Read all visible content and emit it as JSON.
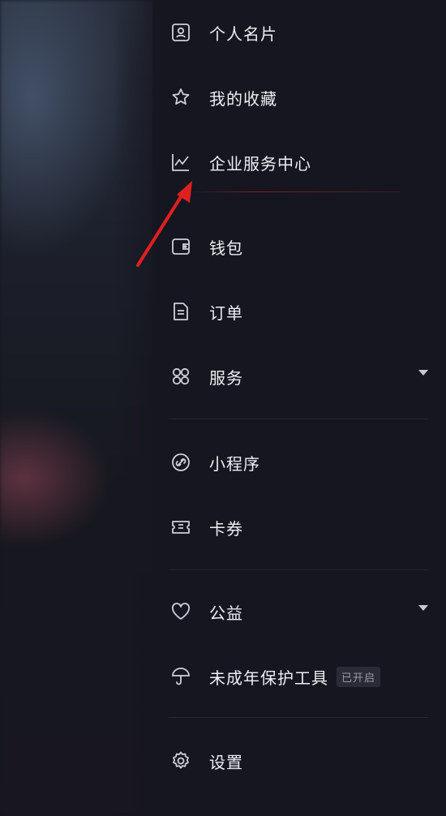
{
  "menu": {
    "items": [
      {
        "label": "个人名片",
        "icon": "contact-card-icon"
      },
      {
        "label": "我的收藏",
        "icon": "star-icon"
      },
      {
        "label": "企业服务中心",
        "icon": "trend-chart-icon"
      },
      {
        "label": "钱包",
        "icon": "wallet-icon"
      },
      {
        "label": "订单",
        "icon": "document-icon"
      },
      {
        "label": "服务",
        "icon": "grid-icon"
      },
      {
        "label": "小程序",
        "icon": "link-icon"
      },
      {
        "label": "卡券",
        "icon": "ticket-icon"
      },
      {
        "label": "公益",
        "icon": "heart-icon"
      },
      {
        "label": "未成年保护工具",
        "icon": "umbrella-icon",
        "badge": "已开启"
      },
      {
        "label": "设置",
        "icon": "gear-icon"
      }
    ]
  },
  "annotation": {
    "arrow_color": "#e02020"
  },
  "colors": {
    "background": "#15161f",
    "text": "#eeeef3",
    "divider": "#262733"
  }
}
